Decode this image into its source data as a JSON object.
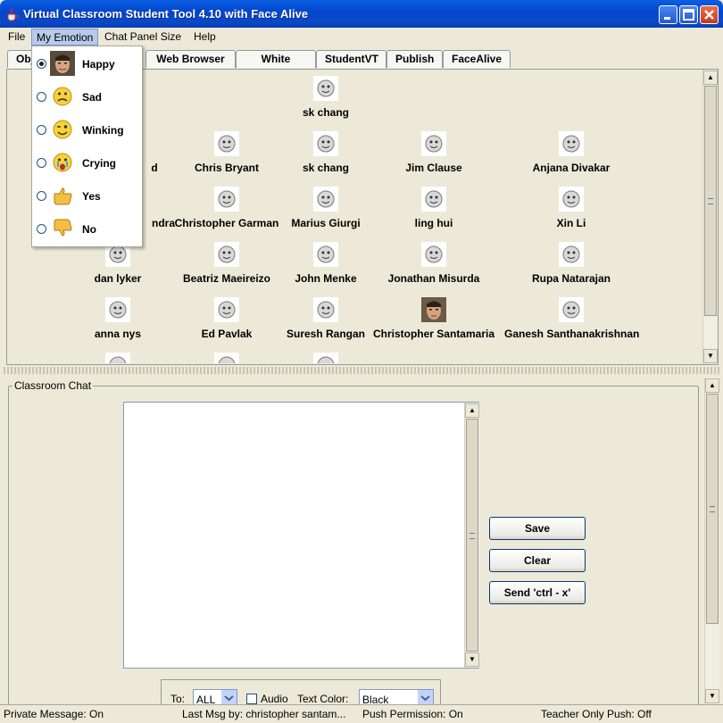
{
  "window": {
    "title": "Virtual Classroom Student Tool 4.10 with Face Alive"
  },
  "menubar": {
    "items": [
      "File",
      "My Emotion",
      "Chat Panel Size",
      "Help"
    ]
  },
  "tabs": [
    "Obj",
    "Web Browser",
    "White Board",
    "StudentVT",
    "Publish",
    "FaceAlive"
  ],
  "emotion_menu": {
    "items": [
      {
        "label": "Happy",
        "selected": true,
        "icon": "photo-face"
      },
      {
        "label": "Sad",
        "selected": false,
        "icon": "sad-smiley"
      },
      {
        "label": "Winking",
        "selected": false,
        "icon": "winking-smiley"
      },
      {
        "label": "Crying",
        "selected": false,
        "icon": "crying-smiley"
      },
      {
        "label": "Yes",
        "selected": false,
        "icon": "thumbs-up"
      },
      {
        "label": "No",
        "selected": false,
        "icon": "thumbs-down"
      }
    ]
  },
  "students": {
    "row0": [
      "sk chang"
    ],
    "row1": [
      "d",
      "Chris Bryant",
      "sk chang",
      "Jim Clause",
      "Anjana Divakar"
    ],
    "row2": [
      "ndra",
      "Christopher Garman",
      "Marius Giurgi",
      "ling hui",
      "Xin Li"
    ],
    "row3": [
      "dan lyker",
      "Beatriz Maeireizo",
      "John Menke",
      "Jonathan Misurda",
      "Rupa Natarajan"
    ],
    "row4": [
      "anna nys",
      "Ed Pavlak",
      "Suresh Rangan",
      "Christopher Santamaria",
      "Ganesh Santhanakrishnan"
    ]
  },
  "chat": {
    "group_title": "Classroom Chat",
    "buttons": {
      "save": "Save",
      "clear": "Clear",
      "send": "Send 'ctrl - x'"
    },
    "to_label": "To:",
    "to_value": "ALL",
    "audio_label": "Audio",
    "text_color_label": "Text Color:",
    "text_color_value": "Black"
  },
  "status": {
    "private": "Private Message: On",
    "last_msg": "Last Msg by: christopher santam...",
    "push": "Push Permission: On",
    "teacher": "Teacher Only Push: Off"
  },
  "colors": {
    "titlebar": "#0a5fe0",
    "menu_highlight": "#b7cbe9",
    "window_bg": "#ece9d8"
  }
}
